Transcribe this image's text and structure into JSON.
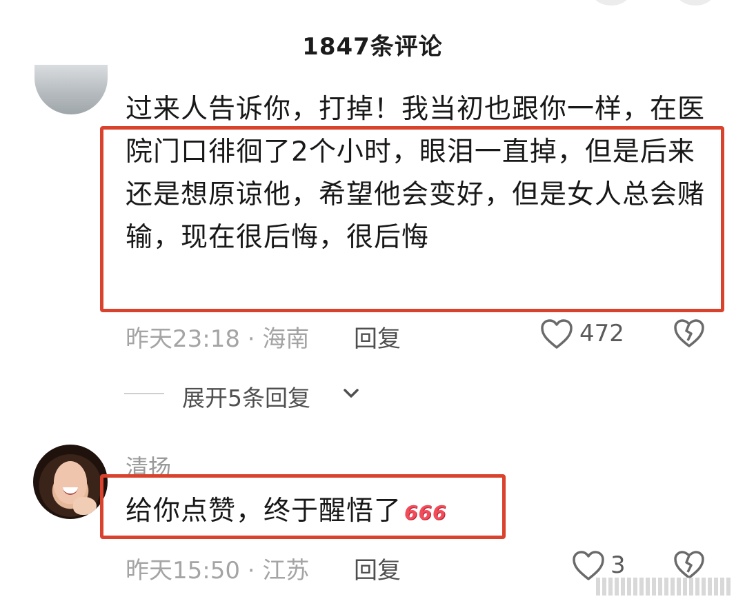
{
  "header": {
    "title": "1847条评论"
  },
  "comments": [
    {
      "text": "过来人告诉你，打掉！我当初也跟你一样，在医院门口徘徊了2个小时，眼泪一直掉，但是后来还是想原谅他，希望他会变好，但是女人总会赌输，现在很后悔，很后悔",
      "meta": "昨天23:18 · 海南",
      "reply_label": "回复",
      "likes": "472",
      "expand_label": "展开5条回复"
    },
    {
      "username": "清扬",
      "text": "给你点赞，终于醒悟了",
      "emoji": "666",
      "meta": "昨天15:50 · 江苏",
      "reply_label": "回复",
      "likes": "3"
    }
  ],
  "colors": {
    "highlight_border": "#d9432d",
    "meta_text": "#a4a4a4",
    "emoji_red": "#f24b5a"
  },
  "icons": [
    "heart-outline-icon",
    "broken-heart-icon",
    "chevron-down-icon"
  ]
}
